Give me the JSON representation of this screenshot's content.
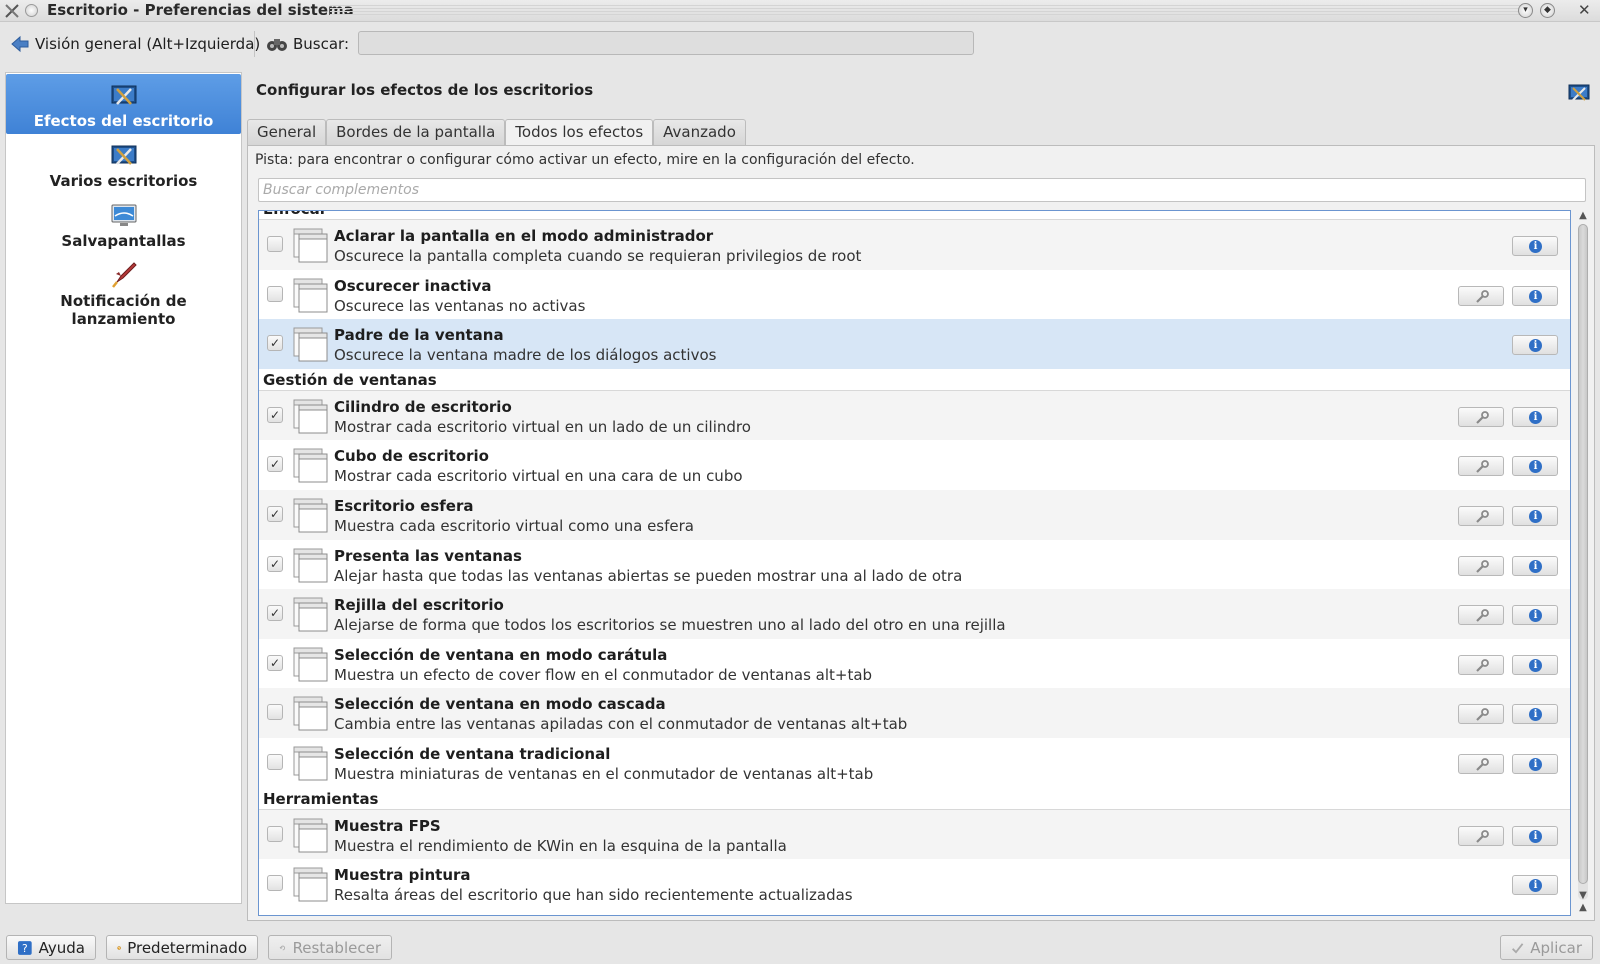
{
  "window": {
    "title": "Escritorio - Preferencias del sistema",
    "close_glyph": "✕"
  },
  "toolbar": {
    "back_label": "Visión general (Alt+Izquierda)",
    "search_label": "Buscar:",
    "search_value": ""
  },
  "sidebar": {
    "items": [
      {
        "label": "Efectos del escritorio",
        "icon": "desktop-effects-icon",
        "selected": true
      },
      {
        "label": "Varios escritorios",
        "icon": "virtual-desktops-icon",
        "selected": false
      },
      {
        "label": "Salvapantallas",
        "icon": "screensaver-icon",
        "selected": false
      },
      {
        "label": "Notificación de lanzamiento",
        "icon": "launch-feedback-icon",
        "selected": false
      }
    ]
  },
  "content": {
    "title": "Configurar los efectos de los escritorios",
    "tabs": [
      {
        "label": "General",
        "active": false
      },
      {
        "label": "Bordes de la pantalla",
        "active": false
      },
      {
        "label": "Todos los efectos",
        "active": true
      },
      {
        "label": "Avanzado",
        "active": false
      }
    ],
    "hint": "Pista: para encontrar o configurar cómo activar un efecto, mire en la configuración del efecto.",
    "plugin_search_placeholder": "Buscar complementos"
  },
  "categories": [
    {
      "name": "Enfocar",
      "effects": [
        {
          "name": "Aclarar la pantalla en el modo administrador",
          "desc": "Oscurece la pantalla completa cuando se requieran privilegios de root",
          "checked": false,
          "configurable": false,
          "selected": false
        },
        {
          "name": "Oscurecer inactiva",
          "desc": "Oscurece las ventanas no activas",
          "checked": false,
          "configurable": true,
          "selected": false
        },
        {
          "name": "Padre de la ventana",
          "desc": "Oscurece la ventana madre de los diálogos activos",
          "checked": true,
          "configurable": false,
          "selected": true
        }
      ]
    },
    {
      "name": "Gestión de ventanas",
      "effects": [
        {
          "name": "Cilindro de escritorio",
          "desc": "Mostrar cada escritorio virtual en un lado de un cilindro",
          "checked": true,
          "configurable": true,
          "selected": false
        },
        {
          "name": "Cubo de escritorio",
          "desc": "Mostrar cada escritorio virtual en una cara de un cubo",
          "checked": true,
          "configurable": true,
          "selected": false
        },
        {
          "name": "Escritorio esfera",
          "desc": "Muestra cada escritorio virtual como una esfera",
          "checked": true,
          "configurable": true,
          "selected": false
        },
        {
          "name": "Presenta las ventanas",
          "desc": "Alejar hasta que todas las ventanas abiertas se pueden mostrar una al lado de otra",
          "checked": true,
          "configurable": true,
          "selected": false
        },
        {
          "name": "Rejilla del escritorio",
          "desc": "Alejarse de forma que todos los escritorios se muestren uno al lado del otro en una rejilla",
          "checked": true,
          "configurable": true,
          "selected": false
        },
        {
          "name": "Selección de ventana en modo carátula",
          "desc": "Muestra un efecto de cover flow en el conmutador de ventanas alt+tab",
          "checked": true,
          "configurable": true,
          "selected": false
        },
        {
          "name": "Selección de ventana en modo cascada",
          "desc": "Cambia entre las ventanas apiladas con el conmutador de ventanas alt+tab",
          "checked": false,
          "configurable": true,
          "selected": false
        },
        {
          "name": "Selección de ventana tradicional",
          "desc": "Muestra miniaturas de ventanas en el conmutador de ventanas alt+tab",
          "checked": false,
          "configurable": true,
          "selected": false
        }
      ]
    },
    {
      "name": "Herramientas",
      "effects": [
        {
          "name": "Muestra FPS",
          "desc": "Muestra el rendimiento de KWin en la esquina de la pantalla",
          "checked": false,
          "configurable": true,
          "selected": false
        },
        {
          "name": "Muestra pintura",
          "desc": "Resalta áreas del escritorio que han sido recientemente actualizadas",
          "checked": false,
          "configurable": false,
          "selected": false
        }
      ]
    }
  ],
  "buttons": {
    "help": "Ayuda",
    "defaults": "Predeterminado",
    "reset": "Restablecer",
    "apply": "Aplicar"
  },
  "colors": {
    "accent": "#3f82d6",
    "selection": "#d7e6f6",
    "info": "#2f6fc6"
  }
}
